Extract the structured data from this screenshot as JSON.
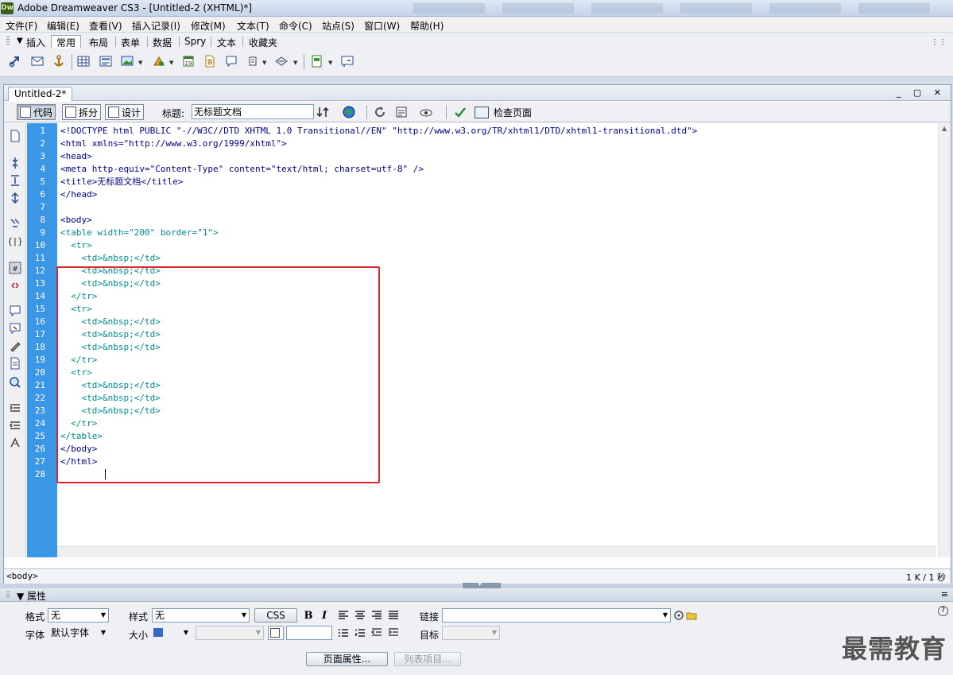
{
  "window": {
    "logo": "Dw",
    "title": "Adobe Dreamweaver CS3 - [Untitled-2 (XHTML)*]"
  },
  "menu": [
    "文件(F)",
    "编辑(E)",
    "查看(V)",
    "插入记录(I)",
    "修改(M)",
    "文本(T)",
    "命令(C)",
    "站点(S)",
    "窗口(W)",
    "帮助(H)"
  ],
  "insert_bar": {
    "label": "插入",
    "tabs": [
      "常用",
      "布局",
      "表单",
      "数据",
      "Spry",
      "文本",
      "收藏夹"
    ],
    "active_tab": "常用",
    "tools": [
      "hyperlink-icon",
      "email-link-icon",
      "named-anchor-icon",
      "table-icon",
      "insert-div-icon",
      "image-icon",
      "media-icon",
      "date-icon",
      "comment-icon",
      "head-icon",
      "script-icon",
      "template-icon",
      "tag-chooser-icon"
    ]
  },
  "document": {
    "tab_label": "Untitled-2*",
    "views": {
      "code": "代码",
      "split": "拆分",
      "design": "设计"
    },
    "active_view": "代码",
    "title_label": "标题:",
    "title_value": "无标题文档",
    "check_page": "检查页面",
    "code_lines": [
      "<!DOCTYPE html PUBLIC \"-//W3C//DTD XHTML 1.0 Transitional//EN\" \"http://www.w3.org/TR/xhtml1/DTD/xhtml1-transitional.dtd\">",
      "<html xmlns=\"http://www.w3.org/1999/xhtml\">",
      "<head>",
      "<meta http-equiv=\"Content-Type\" content=\"text/html; charset=utf-8\" />",
      "<title>无标题文档</title>",
      "</head>",
      "",
      "<body>",
      "<table width=\"200\" border=\"1\">",
      "  <tr>",
      "    <td>&nbsp;</td>",
      "    <td>&nbsp;</td>",
      "    <td>&nbsp;</td>",
      "  </tr>",
      "  <tr>",
      "    <td>&nbsp;</td>",
      "    <td>&nbsp;</td>",
      "    <td>&nbsp;</td>",
      "  </tr>",
      "  <tr>",
      "    <td>&nbsp;</td>",
      "    <td>&nbsp;</td>",
      "    <td>&nbsp;</td>",
      "  </tr>",
      "</table>",
      "</body>",
      "</html>",
      ""
    ],
    "status_tag": "<body>",
    "status_size": "1 K / 1 秒"
  },
  "properties": {
    "header": "属性",
    "format_label": "格式",
    "format_value": "无",
    "style_label": "样式",
    "style_value": "无",
    "css_button": "CSS",
    "bold": "B",
    "italic": "I",
    "link_label": "链接",
    "link_value": "",
    "font_label": "字体",
    "font_value": "默认字体",
    "size_label": "大小",
    "target_label": "目标",
    "page_props_button": "页面属性...",
    "list_item_button": "列表项目..."
  },
  "watermark": "最需教育",
  "colors": {
    "gutter": "#3c96e6",
    "highlight_box": "#e2232a",
    "tag_blue": "#00008b",
    "tag_teal": "#008b8b"
  }
}
